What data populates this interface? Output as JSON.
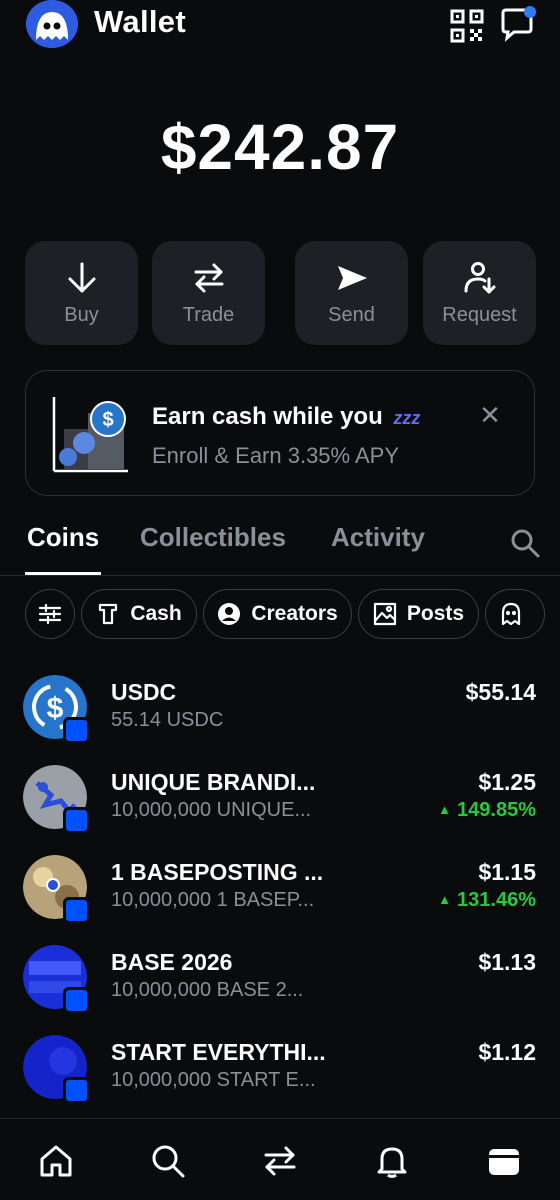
{
  "header": {
    "title": "Wallet",
    "avatar_icon": "ghost-avatar-icon",
    "qr_icon": "qr-code-icon",
    "chat_icon": "chat-bubble-icon"
  },
  "balance": {
    "total": "$242.87"
  },
  "actions": [
    {
      "label": "Buy",
      "icon": "arrow-down-icon"
    },
    {
      "label": "Trade",
      "icon": "swap-arrows-icon"
    },
    {
      "label": "Send",
      "icon": "send-arrow-icon"
    },
    {
      "label": "Request",
      "icon": "person-request-icon"
    }
  ],
  "promo": {
    "title": "Earn cash while you",
    "title_emoji": "sleeping-zzz-icon",
    "subtitle": "Enroll & Earn 3.35% APY"
  },
  "tabs": [
    {
      "label": "Coins",
      "active": true
    },
    {
      "label": "Collectibles",
      "active": false
    },
    {
      "label": "Activity",
      "active": false
    }
  ],
  "filters": [
    {
      "label": "",
      "icon": "sliders-icon"
    },
    {
      "label": "Cash",
      "icon": "cash-icon"
    },
    {
      "label": "Creators",
      "icon": "person-circle-icon"
    },
    {
      "label": "Posts",
      "icon": "image-icon"
    },
    {
      "label": "",
      "icon": "ghost-icon"
    }
  ],
  "coins": [
    {
      "name": "USDC",
      "amount": "55.14 USDC",
      "value": "$55.14",
      "change": ""
    },
    {
      "name": "UNIQUE BRANDI...",
      "amount": "10,000,000 UNIQUE...",
      "value": "$1.25",
      "change": "149.85%"
    },
    {
      "name": "1 BASEPOSTING ...",
      "amount": "10,000,000 1 BASEP...",
      "value": "$1.15",
      "change": "131.46%"
    },
    {
      "name": "BASE 2026",
      "amount": "10,000,000 BASE 2...",
      "value": "$1.13",
      "change": ""
    },
    {
      "name": "START EVERYTHI...",
      "amount": "10,000,000 START E...",
      "value": "$1.12",
      "change": ""
    }
  ],
  "bottom_nav": [
    {
      "icon": "home-icon"
    },
    {
      "icon": "search-icon"
    },
    {
      "icon": "swap-arrows-icon"
    },
    {
      "icon": "bell-icon"
    },
    {
      "icon": "wallet-icon"
    }
  ],
  "colors": {
    "background": "#0a0b0d",
    "surface": "#1e2025",
    "muted_text": "#8a8f98",
    "positive": "#27c93f",
    "brand_blue": "#0052ff",
    "usdc_blue": "#2775ca"
  }
}
